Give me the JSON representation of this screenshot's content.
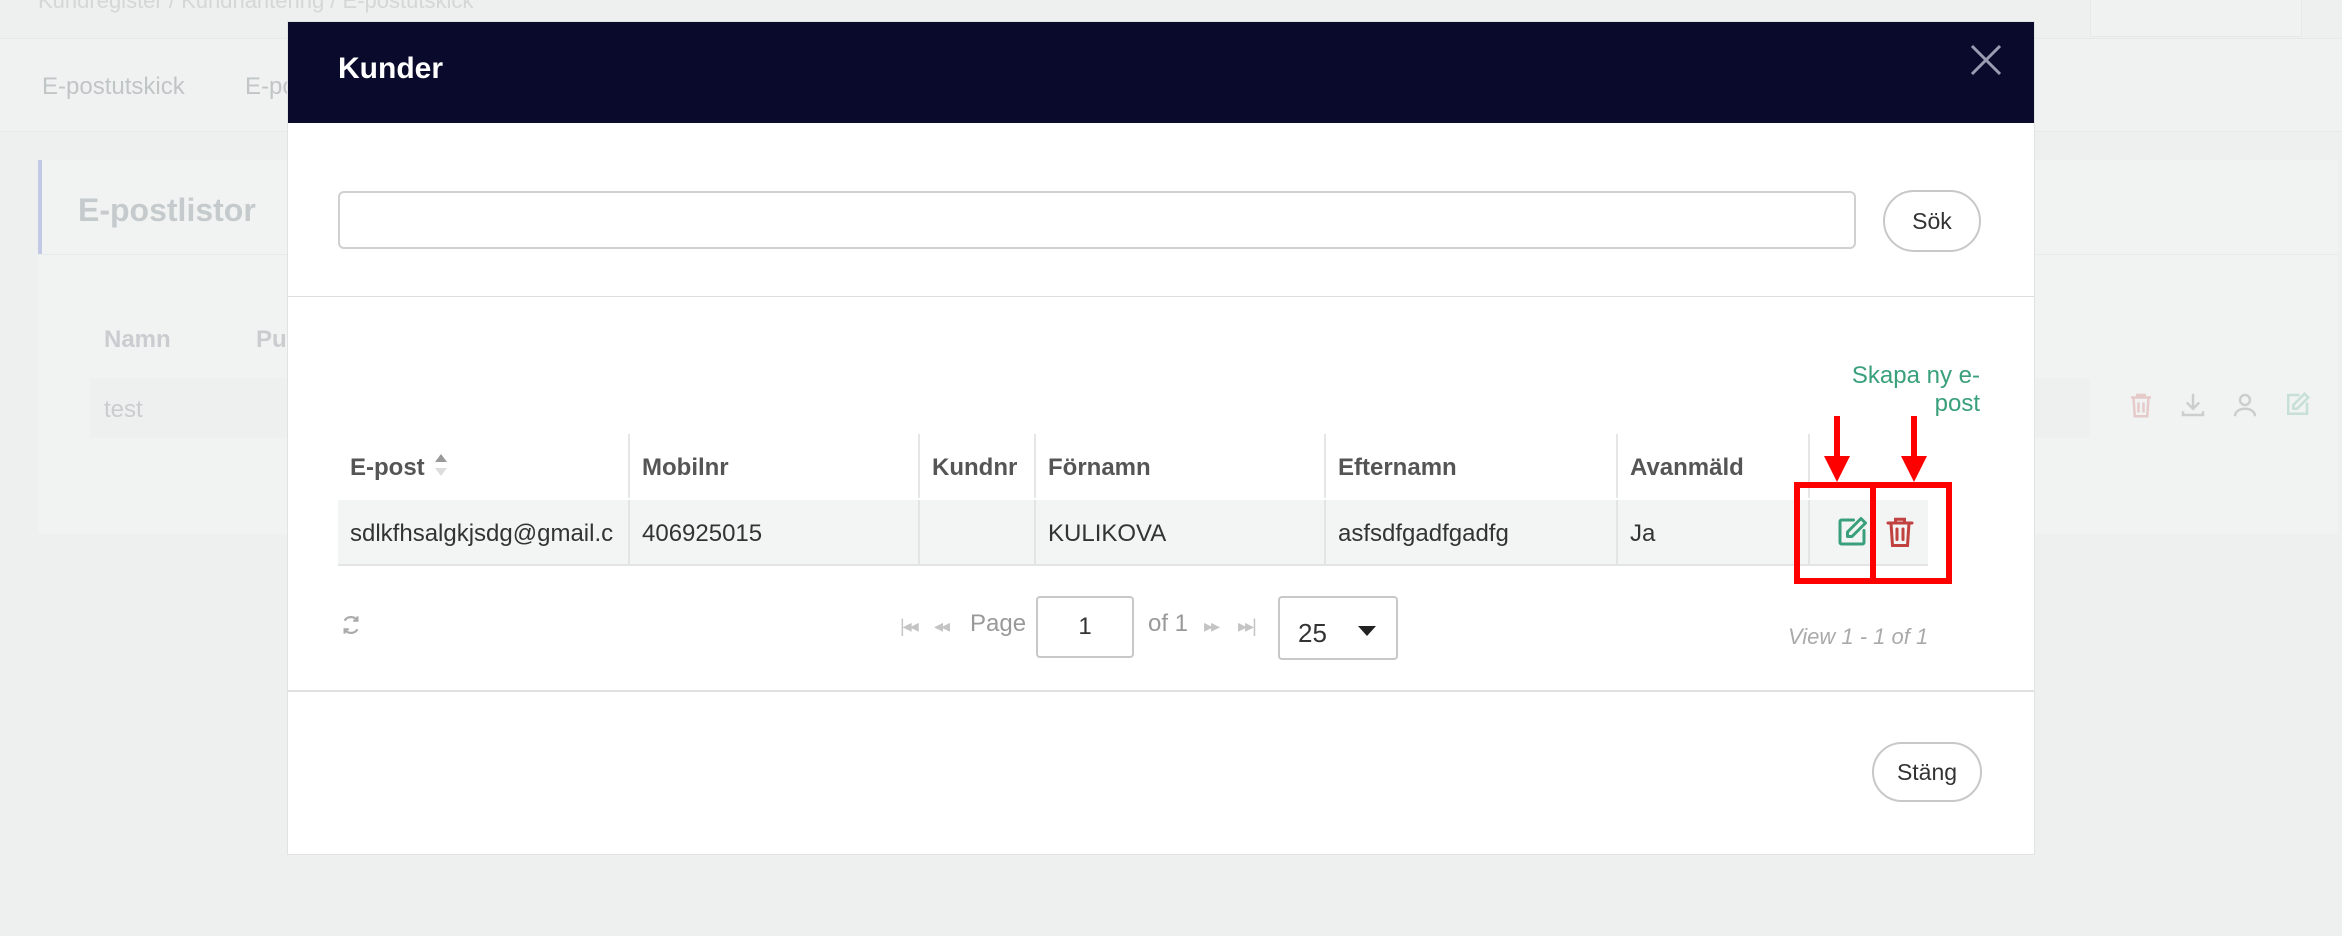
{
  "background": {
    "breadcrumb": "Kundregister / Kundhantering / E-postutskick",
    "tabs": [
      "E-postutskick",
      "E-po"
    ],
    "panel_title": "E-postlistor",
    "columns": [
      "Namn",
      "Pu"
    ],
    "row_name": "test"
  },
  "modal": {
    "title": "Kunder",
    "search": {
      "value": "",
      "button": "Sök"
    },
    "create_link": "Skapa ny e-post",
    "columns": {
      "email": "E-post",
      "mobile": "Mobilnr",
      "custno": "Kundnr",
      "firstname": "Förnamn",
      "lastname": "Efternamn",
      "unsubscribed": "Avanmäld"
    },
    "rows": [
      {
        "email": "sdlkfhsalgkjsdg@gmail.c",
        "mobile": "406925015",
        "custno": "",
        "firstname": "KULIKOVA",
        "lastname": "asfsdfgadfgadfg",
        "unsubscribed": "Ja"
      }
    ],
    "pager": {
      "page_label": "Page",
      "page": "1",
      "of_label": "of 1",
      "page_size": "25",
      "view_text": "View 1 - 1 of 1"
    },
    "close_button": "Stäng"
  },
  "colors": {
    "header_bg": "#0a0b2c",
    "accent_green": "#3aa07b",
    "delete_red": "#c0413f",
    "annotation_red": "#ff0000"
  },
  "icons": [
    "close-icon",
    "sort-icon",
    "edit-icon",
    "trash-icon",
    "refresh-icon",
    "download-icon",
    "user-icon"
  ]
}
